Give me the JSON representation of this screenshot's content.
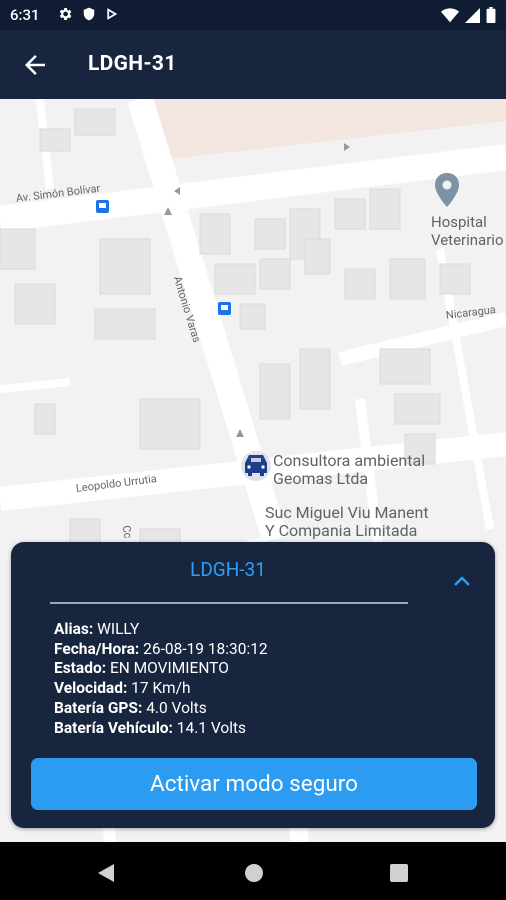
{
  "status_bar": {
    "time": "6:31",
    "left_icons": [
      "gear-icon",
      "shield-icon",
      "play-store-icon"
    ],
    "right_icons": [
      "wifi-icon",
      "signal-icon",
      "battery-icon"
    ]
  },
  "app_bar": {
    "title": "LDGH-31",
    "back_icon": "arrow-left-icon"
  },
  "map": {
    "places": [
      {
        "name": "Hospital Veterinario",
        "line1": "Hospital",
        "line2": "Veterinario"
      },
      {
        "name": "Consultora ambiental Geomas Ltda",
        "line1": "Consultora ambiental",
        "line2": "Geomas Ltda"
      },
      {
        "name": "Suc Miguel Viu Manent Y Compania Limitada",
        "line1": "Suc Miguel Viu Manent",
        "line2": "Y Compania Limitada"
      }
    ],
    "streets": [
      "Av. Simón Bolívar",
      "Antonio Varas",
      "Nicaragua",
      "Leopoldo Urrutia",
      "Cc"
    ]
  },
  "card": {
    "title": "LDGH-31",
    "collapse_icon": "chevron-up-icon",
    "info": [
      {
        "label": "Alias:",
        "value": "WILLY"
      },
      {
        "label": "Fecha/Hora:",
        "value": "26-08-19 18:30:12"
      },
      {
        "label": "Estado:",
        "value": "EN MOVIMIENTO"
      },
      {
        "label": "Velocidad:",
        "value": "17 Km/h"
      },
      {
        "label": "Batería GPS:",
        "value": "4.0 Volts"
      },
      {
        "label": "Batería Vehículo:",
        "value": "14.1 Volts"
      }
    ],
    "button_label": "Activar modo seguro"
  },
  "colors": {
    "status_bar": "#0f1c33",
    "app_bar": "#18253f",
    "card_bg": "#18253f",
    "accent": "#2b9cf1",
    "title_accent": "#2f9ef2"
  },
  "nav_bar": [
    "back-triangle-icon",
    "home-circle-icon",
    "recents-square-icon"
  ]
}
